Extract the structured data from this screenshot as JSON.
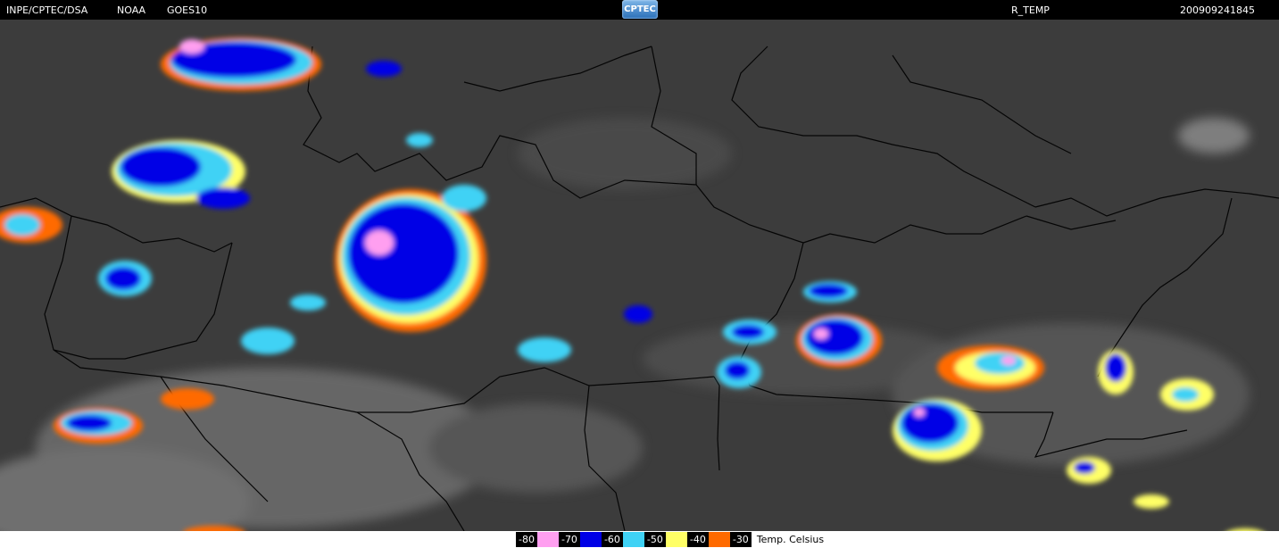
{
  "header": {
    "source": "INPE/CPTEC/DSA",
    "agency": "NOAA",
    "satellite": "GOES10",
    "logo_text": "CPTEC",
    "product": "R_TEMP",
    "timestamp": "200909241845"
  },
  "legend": {
    "unit_label": "Temp. Celsius",
    "items": [
      {
        "value": "-80",
        "color": "#ff9ff0"
      },
      {
        "value": "-70",
        "color": "#0000e6"
      },
      {
        "value": "-60",
        "color": "#3fd2f5"
      },
      {
        "value": "-50",
        "color": "#ffff66"
      },
      {
        "value": "-40",
        "color": "#ff6a00"
      },
      {
        "value": "-30",
        "color": null
      }
    ]
  },
  "colors": {
    "background": "#3a3a3a",
    "borders": "#000000",
    "cloud_gray": "#9a9a9a"
  }
}
